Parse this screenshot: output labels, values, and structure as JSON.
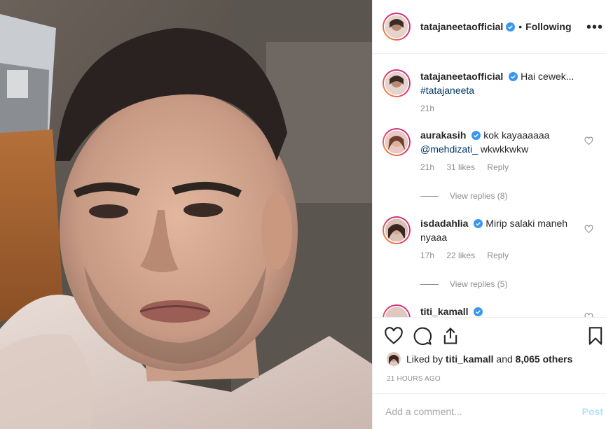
{
  "post": {
    "author": "tatajaneetaofficial",
    "follow_status": "Following",
    "separator": "•",
    "more": "•••",
    "caption_text": "Hai cewek...",
    "caption_hashtag": "#tatajaneeta",
    "caption_time": "21h"
  },
  "comments": [
    {
      "username": "aurakasih",
      "text": "kok kayaaaaaa",
      "mention": "@mehdizati_",
      "text2": "wkwkkwkw",
      "time": "21h",
      "likes": "31 likes",
      "reply": "Reply",
      "view_replies": "View replies (8)"
    },
    {
      "username": "isdadahlia",
      "text": "Mirip salaki maneh nyaaa",
      "time": "17h",
      "likes": "22 likes",
      "reply": "Reply",
      "view_replies": "View replies (5)"
    },
    {
      "username": "titi_kamall"
    }
  ],
  "likes": {
    "prefix": "Liked by",
    "user": "titi_kamall",
    "middle": "and",
    "others": "8,065 others"
  },
  "time_ago": "21 HOURS AGO",
  "add_comment": {
    "placeholder": "Add a comment...",
    "post_label": "Post"
  },
  "colors": {
    "verified": "#3897f0",
    "link": "#00376b",
    "muted": "#8e8e8e"
  },
  "icons": [
    "heart-icon",
    "comment-icon",
    "share-icon",
    "bookmark-icon",
    "verified-icon",
    "more-icon"
  ]
}
